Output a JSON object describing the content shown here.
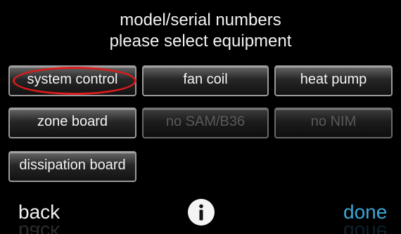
{
  "header": {
    "line1": "model/serial numbers",
    "line2": "please select equipment"
  },
  "equipment_buttons": [
    {
      "label": "system control",
      "enabled": true,
      "highlighted": true
    },
    {
      "label": "fan coil",
      "enabled": true,
      "highlighted": false
    },
    {
      "label": "heat pump",
      "enabled": true,
      "highlighted": false
    },
    {
      "label": "zone board",
      "enabled": true,
      "highlighted": false
    },
    {
      "label": "no SAM/B36",
      "enabled": false,
      "highlighted": false
    },
    {
      "label": "no NIM",
      "enabled": false,
      "highlighted": false
    },
    {
      "label": "dissipation board",
      "enabled": true,
      "highlighted": false
    }
  ],
  "footer": {
    "back_label": "back",
    "info_icon": "info-icon",
    "done_label": "done"
  },
  "colors": {
    "background": "#000000",
    "done_accent": "#3ca6d8",
    "highlight_ring": "#d91c1c"
  }
}
